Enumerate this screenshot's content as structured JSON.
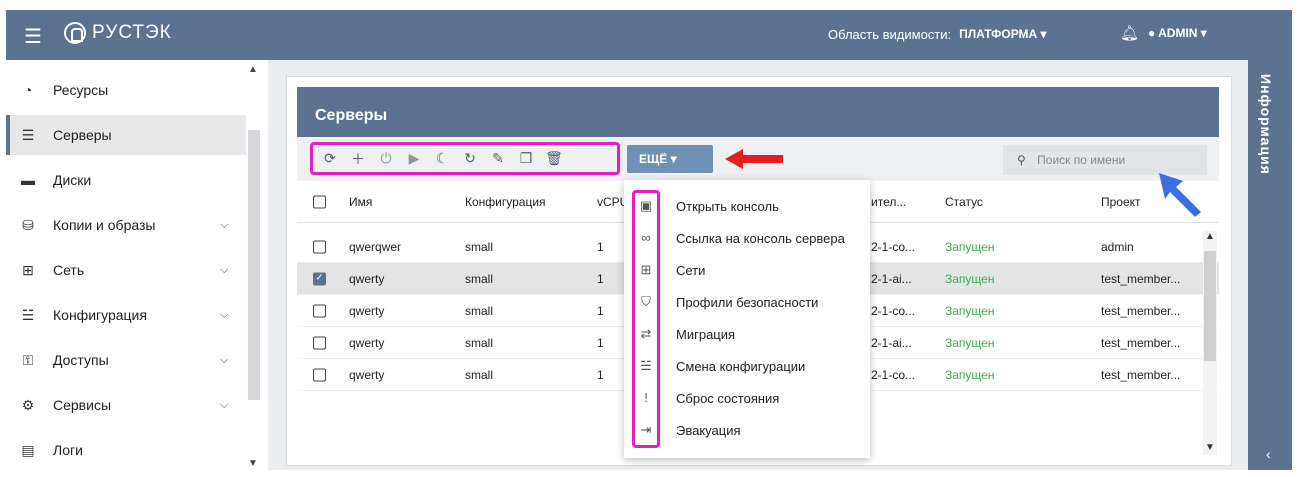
{
  "header": {
    "logo_text": "РУСТЭК",
    "scope_label": "Область видимости:",
    "scope_value": "ПЛАТФОРМА ▾",
    "user": "ADMIN ▾"
  },
  "sidebar": {
    "items": [
      {
        "label": "Ресурсы",
        "icon": "pie-chart-icon"
      },
      {
        "label": "Серверы",
        "icon": "server-icon",
        "active": true
      },
      {
        "label": "Диски",
        "icon": "drive-icon"
      },
      {
        "label": "Копии и образы",
        "icon": "database-icon",
        "chevron": true
      },
      {
        "label": "Сеть",
        "icon": "network-icon",
        "chevron": true
      },
      {
        "label": "Конфигурация",
        "icon": "sliders-icon",
        "chevron": true
      },
      {
        "label": "Доступы",
        "icon": "key-icon",
        "chevron": true
      },
      {
        "label": "Сервисы",
        "icon": "gears-icon",
        "chevron": true
      },
      {
        "label": "Логи",
        "icon": "scroll-icon"
      }
    ]
  },
  "info_panel": {
    "label": "Информация"
  },
  "card": {
    "title": "Серверы",
    "more_button": "ЕЩЁ ▾",
    "search_placeholder": "Поиск по имени",
    "columns": {
      "name": "Имя",
      "config": "Конфигурация",
      "vcpu": "vCPU",
      "source": "ител...",
      "status": "Статус",
      "project": "Проект"
    },
    "rows": [
      {
        "name": "qwerqwer",
        "config": "small",
        "vcpu": "1",
        "source": "2-1-co...",
        "status": "Запущен",
        "project": "admin",
        "checked": false
      },
      {
        "name": "qwerty",
        "config": "small",
        "vcpu": "1",
        "source": "2-1-ai...",
        "status": "Запущен",
        "project": "test_member...",
        "checked": true
      },
      {
        "name": "qwerty",
        "config": "small",
        "vcpu": "1",
        "source": "2-1-co...",
        "status": "Запущен",
        "project": "test_member...",
        "checked": false
      },
      {
        "name": "qwerty",
        "config": "small",
        "vcpu": "1",
        "source": "2-1-ai...",
        "status": "Запущен",
        "project": "test_member...",
        "checked": false
      },
      {
        "name": "qwerty",
        "config": "small",
        "vcpu": "1",
        "source": "2-1-co...",
        "status": "Запущен",
        "project": "test_member...",
        "checked": false
      }
    ]
  },
  "menu": {
    "items": [
      {
        "label": "Открыть консоль",
        "icon": "console-icon"
      },
      {
        "label": "Ссылка на консоль сервера",
        "icon": "link-icon"
      },
      {
        "label": "Сети",
        "icon": "network-icon"
      },
      {
        "label": "Профили безопасности",
        "icon": "shield-icon"
      },
      {
        "label": "Миграция",
        "icon": "swap-arrows-icon"
      },
      {
        "label": "Смена конфигурации",
        "icon": "sliders-icon"
      },
      {
        "label": "Сброс состояния",
        "icon": "exclamation-icon"
      },
      {
        "label": "Эвакуация",
        "icon": "sign-in-icon"
      }
    ]
  },
  "colors": {
    "header": "#5b7390",
    "highlight": "#e020c0",
    "status_running": "#3cae4c",
    "more_button": "#7090b4"
  }
}
